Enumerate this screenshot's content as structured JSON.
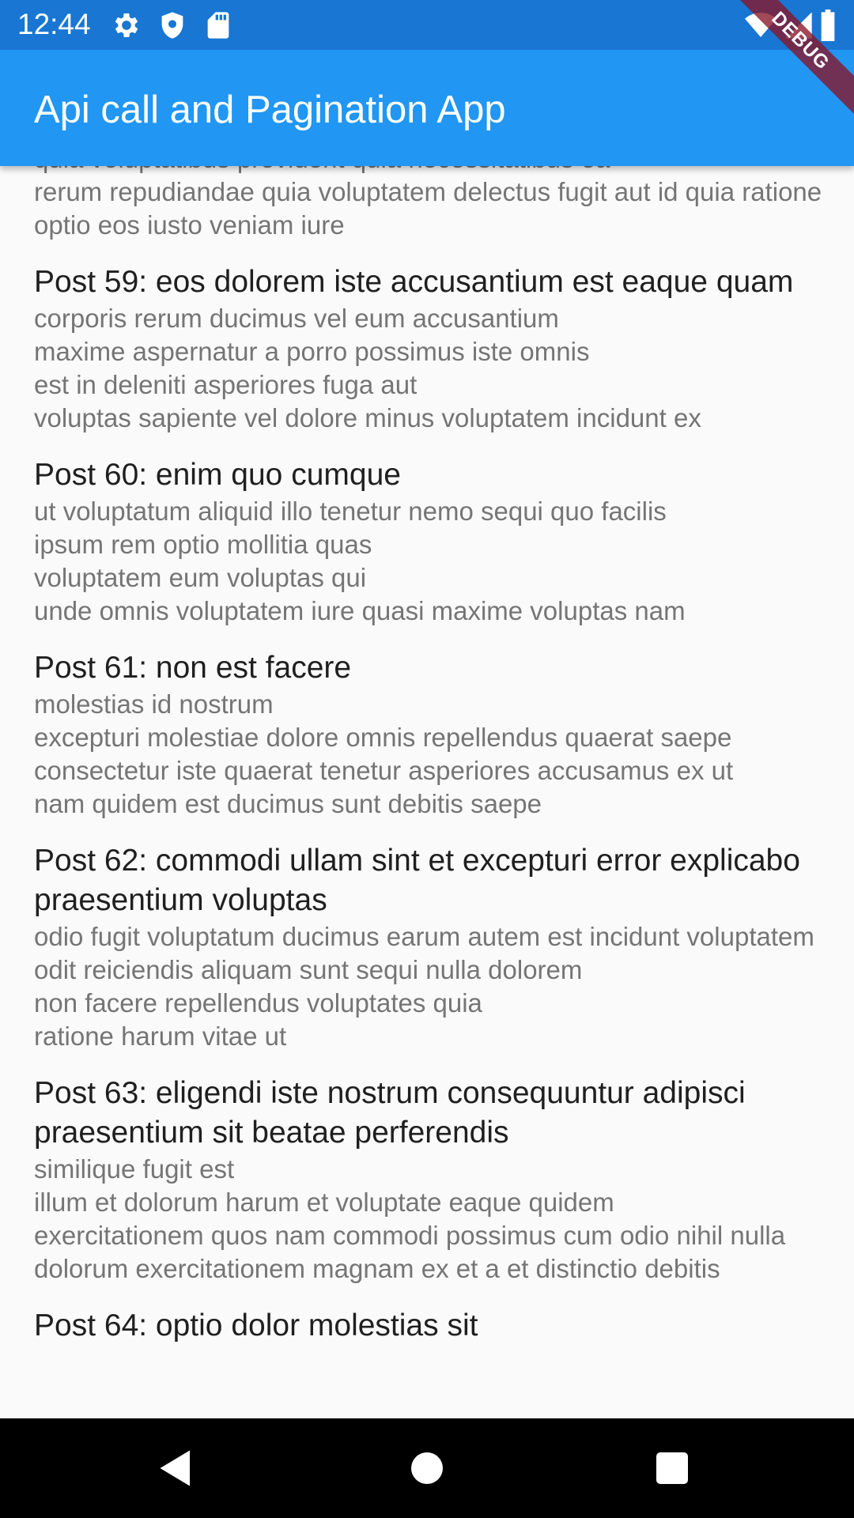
{
  "status_bar": {
    "time": "12:44",
    "left_icons": [
      "gear-icon",
      "shield-icon",
      "sd-card-icon"
    ],
    "right_icons": [
      "wifi-icon",
      "signal-icon",
      "battery-icon"
    ],
    "color": "#1976d2"
  },
  "app_bar": {
    "title": "Api call and Pagination App",
    "color": "#2196f3"
  },
  "debug_banner": "DEBUG",
  "posts": [
    {
      "title": "",
      "body": "quia voluptatibus provident quia necessitatibus ea\nrerum repudiandae quia voluptatem delectus fugit aut id quia ratione optio eos iusto veniam iure"
    },
    {
      "title": "Post 59: eos dolorem iste accusantium est eaque quam",
      "body": "corporis rerum ducimus vel eum accusantium\nmaxime aspernatur a porro possimus iste omnis\nest in deleniti asperiores fuga aut\nvoluptas sapiente vel dolore minus voluptatem incidunt ex"
    },
    {
      "title": "Post 60: enim quo cumque",
      "body": "ut voluptatum aliquid illo tenetur nemo sequi quo facilis\nipsum rem optio mollitia quas\nvoluptatem eum voluptas qui\nunde omnis voluptatem iure quasi maxime voluptas nam"
    },
    {
      "title": "Post 61: non est facere",
      "body": "molestias id nostrum\nexcepturi molestiae dolore omnis repellendus quaerat saepe\nconsectetur iste quaerat tenetur asperiores accusamus ex ut\nnam quidem est ducimus sunt debitis saepe"
    },
    {
      "title": "Post 62: commodi ullam sint et excepturi error explicabo praesentium voluptas",
      "body": "odio fugit voluptatum ducimus earum autem est incidunt voluptatem\nodit reiciendis aliquam sunt sequi nulla dolorem\nnon facere repellendus voluptates quia\nratione harum vitae ut"
    },
    {
      "title": "Post 63: eligendi iste nostrum consequuntur adipisci praesentium sit beatae perferendis",
      "body": "similique fugit est\nillum et dolorum harum et voluptate eaque quidem\nexercitationem quos nam commodi possimus cum odio nihil nulla\ndolorum exercitationem magnam ex et a et distinctio debitis"
    },
    {
      "title": "Post 64: optio dolor molestias sit",
      "body": ""
    }
  ],
  "nav_bar": {
    "buttons": [
      "back-icon",
      "home-icon",
      "recents-icon"
    ]
  }
}
